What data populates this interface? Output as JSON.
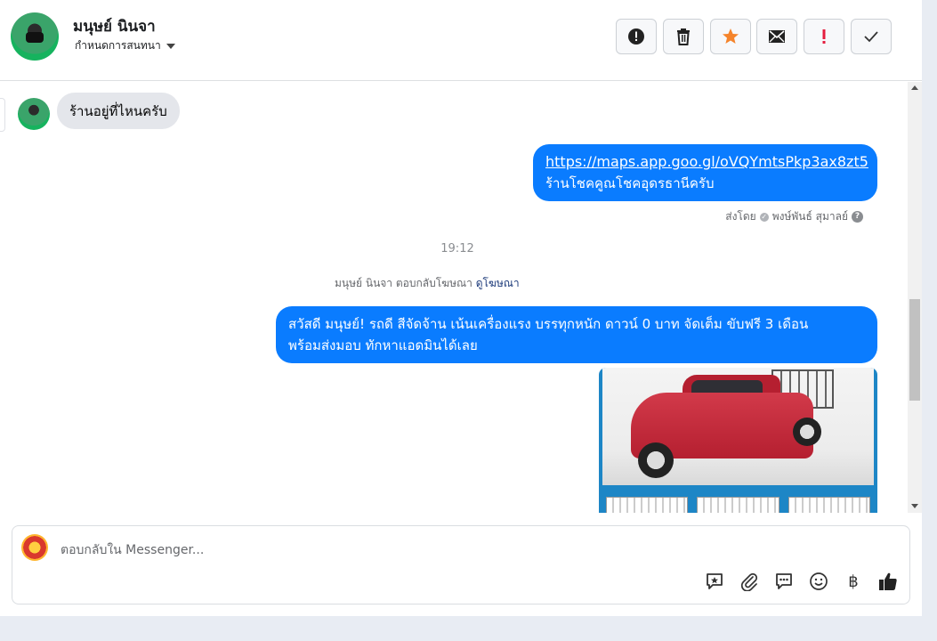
{
  "header": {
    "contact_name": "มนุษย์ นินจา",
    "assign_label": "กำหนดการสนทนา",
    "actions": [
      {
        "name": "spam-button",
        "icon": "alert-circle-icon"
      },
      {
        "name": "delete-button",
        "icon": "trash-icon"
      },
      {
        "name": "star-button",
        "icon": "star-icon",
        "color": "#f5842b"
      },
      {
        "name": "mark-unread-button",
        "icon": "envelope-icon"
      },
      {
        "name": "important-button",
        "icon": "exclamation-icon",
        "color": "#e41e3f"
      },
      {
        "name": "done-button",
        "icon": "check-icon"
      }
    ]
  },
  "messages": {
    "incoming_1": "ร้านอยู่ที่ไหนครับ",
    "outgoing_1_link": "https://maps.app.goo.gl/oVQYmtsPkp3ax8zt5",
    "outgoing_1_text": "ร้านโชคคูณโชคอุดรธานีครับ",
    "sent_by_prefix": "ส่งโดย",
    "sent_by_name": "พงษ์พันธ์ สุมาลย์",
    "timestamp": "19:12",
    "reply_note": "มนุษย์ นินจา ตอบกลับโฆษณา",
    "view_ad_link": "ดูโฆษณา",
    "outgoing_2_line1": "สวัสดี มนุษย์! รถดี สีจัดจ้าน เน้นเครื่องแรง บรรทุกหนัก ดาวน์ 0 บาท จัดเต็ม ขับฟรี 3 เดือน",
    "outgoing_2_line2": "พร้อมส่งมอบ ทักหาแอดมินได้เลย"
  },
  "composer": {
    "placeholder": "ตอบกลับใน Messenger...",
    "tools": [
      "saved-reply-icon",
      "attachment-icon",
      "message-icon",
      "emoji-icon",
      "baht-icon",
      "thumbs-up-icon"
    ],
    "baht_symbol": "฿"
  },
  "colors": {
    "accent": "#0a7cff",
    "incoming_bubble": "#e4e6eb"
  }
}
